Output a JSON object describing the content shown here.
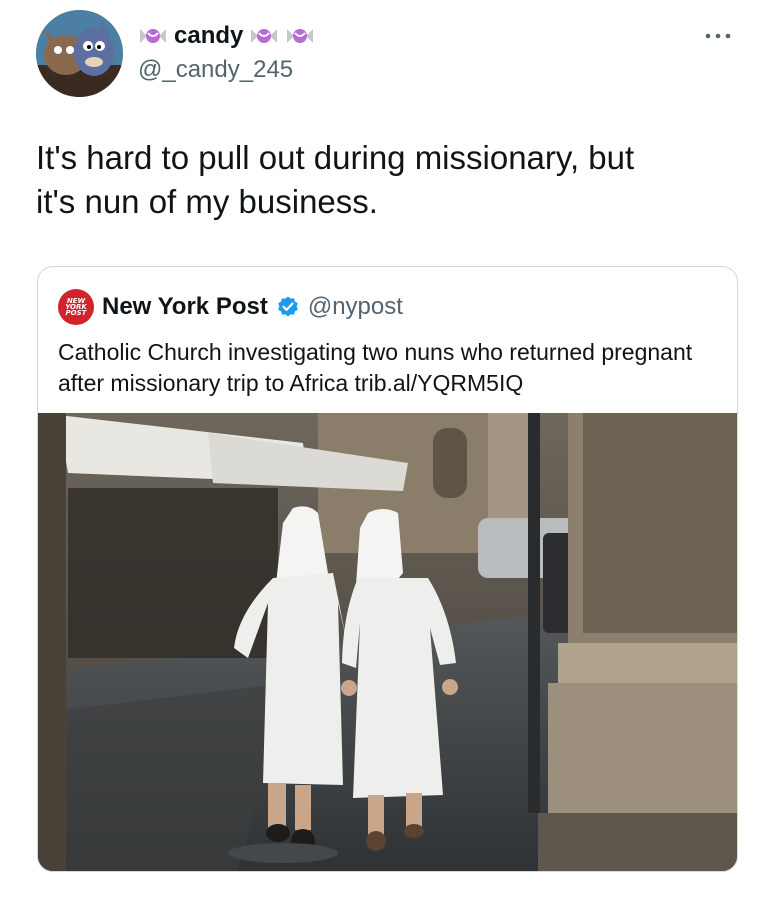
{
  "tweet": {
    "display_name": "candy",
    "handle": "@_candy_245",
    "text": "It's hard to pull out during missionary, but\nit's nun of my business.",
    "more_icon": "more-horizontal-icon",
    "name_emoji_icon": "candy-icon"
  },
  "quote": {
    "name": "New York Post",
    "handle": "@nypost",
    "text": "Catholic Church investigating two nuns who returned pregnant after missionary trip to Africa trib.al/YQRM5IQ",
    "logo_text": "NEW YORK POST",
    "verified_icon": "verified-badge-icon",
    "verified_color": "#1d9bf0",
    "logo_color": "#d2232a"
  }
}
